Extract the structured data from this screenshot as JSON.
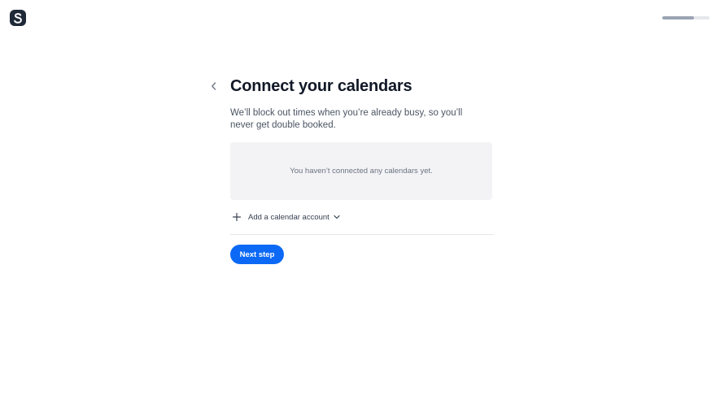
{
  "header": {
    "logo_letter": "S",
    "progress_fraction": 0.68
  },
  "main": {
    "title": "Connect your calendars",
    "subtitle": "We’ll block out times when you’re already busy, so you’ll never get double booked.",
    "empty_message": "You haven’t connected any calendars yet.",
    "add_account_label": "Add a calendar account",
    "next_button_label": "Next step"
  },
  "colors": {
    "accent": "#0b69f5",
    "logo_bg": "#1f2937",
    "empty_box_bg": "#f3f3f6"
  },
  "icons": {
    "back": "chevron-left-icon",
    "add": "plus-icon",
    "dropdown": "chevron-down-icon"
  }
}
